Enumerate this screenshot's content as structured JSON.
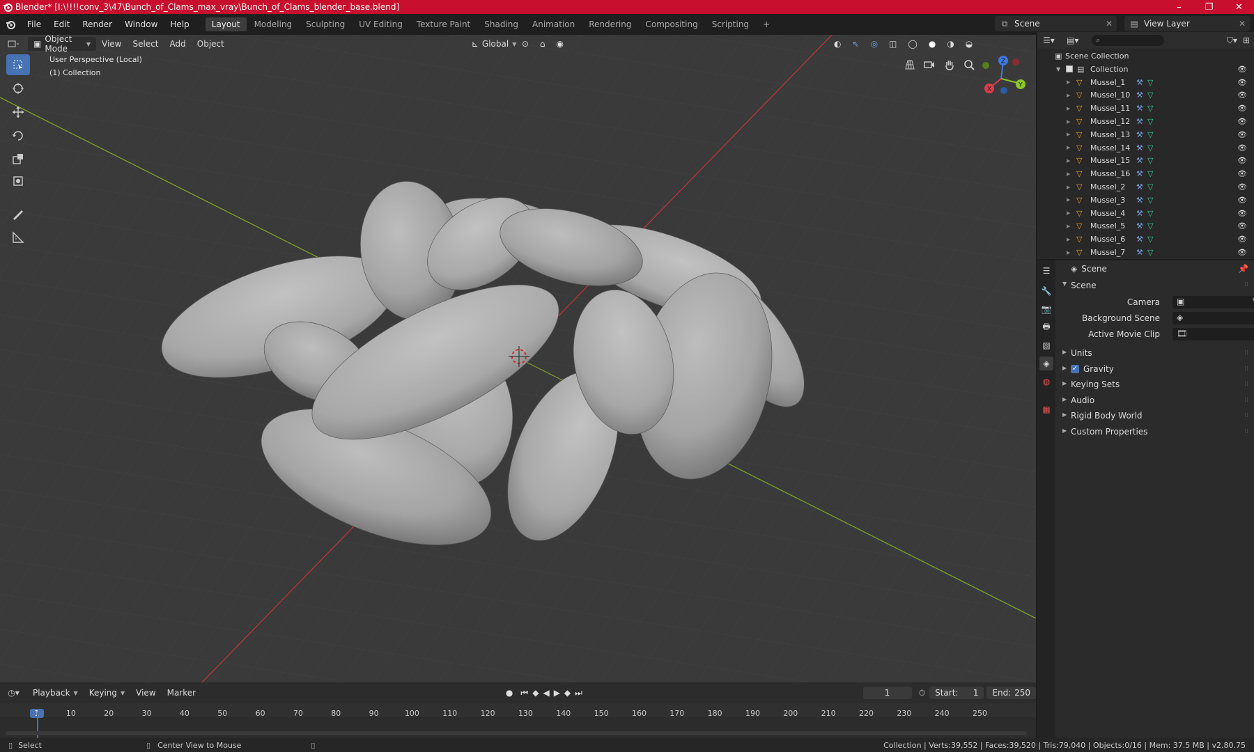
{
  "window": {
    "title": "Blender* [I:\\!!!!conv_3\\47\\Bunch_of_Clams_max_vray\\Bunch_of_Clams_blender_base.blend]",
    "controls": [
      "–",
      "❐",
      "✕"
    ]
  },
  "menu": {
    "items": [
      "File",
      "Edit",
      "Render",
      "Window",
      "Help"
    ],
    "workspaces": [
      "Layout",
      "Modeling",
      "Sculpting",
      "UV Editing",
      "Texture Paint",
      "Shading",
      "Animation",
      "Rendering",
      "Compositing",
      "Scripting"
    ],
    "active_workspace": "Layout",
    "add_workspace": "+",
    "scene": "Scene",
    "view_layer": "View Layer"
  },
  "viewport": {
    "mode": "Object Mode",
    "menus": [
      "View",
      "Select",
      "Add",
      "Object"
    ],
    "orientation": "Global",
    "perspective": "User Perspective (Local)",
    "collection": "(1) Collection",
    "gizmo": {
      "x": "X",
      "y": "Y",
      "z": "Z"
    },
    "background": "#3a3a3a",
    "x_axis_color": "#b8373d",
    "y_axis_color": "#7ea02a"
  },
  "outliner": {
    "root": "Scene Collection",
    "collection": "Collection",
    "objects": [
      "Mussel_1",
      "Mussel_10",
      "Mussel_11",
      "Mussel_12",
      "Mussel_13",
      "Mussel_14",
      "Mussel_15",
      "Mussel_16",
      "Mussel_2",
      "Mussel_3",
      "Mussel_4",
      "Mussel_5",
      "Mussel_6",
      "Mussel_7"
    ]
  },
  "properties": {
    "context": "Scene",
    "panel": "Scene",
    "fields": [
      {
        "label": "Camera"
      },
      {
        "label": "Background Scene"
      },
      {
        "label": "Active Movie Clip"
      }
    ],
    "sections": [
      "Units",
      "Gravity",
      "Keying Sets",
      "Audio",
      "Rigid Body World",
      "Custom Properties"
    ],
    "gravity_enabled": true
  },
  "timeline": {
    "menus": [
      "Playback",
      "Keying",
      "View",
      "Marker"
    ],
    "current_frame": "1",
    "start_label": "Start:",
    "start": "1",
    "end_label": "End:",
    "end": "250",
    "ticks": [
      "1",
      "10",
      "20",
      "30",
      "40",
      "50",
      "60",
      "70",
      "80",
      "90",
      "100",
      "110",
      "120",
      "130",
      "140",
      "150",
      "160",
      "170",
      "180",
      "190",
      "200",
      "210",
      "220",
      "230",
      "240",
      "250"
    ]
  },
  "status": {
    "left_action": "Select",
    "middle_action": "Center View to Mouse",
    "stats": "Collection | Verts:39,552 | Faces:39,520 | Tris:79,040 | Objects:0/16 | Mem: 37.5 MB | v2.80.75"
  }
}
